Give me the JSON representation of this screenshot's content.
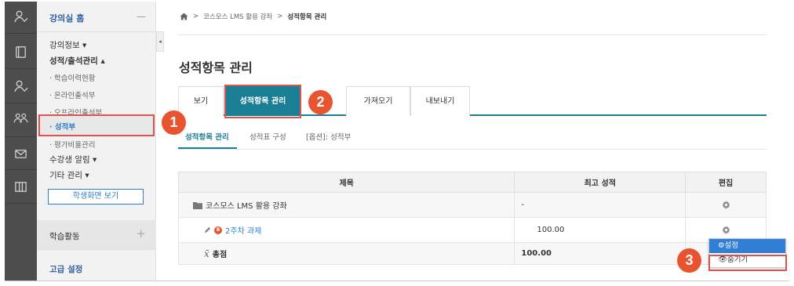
{
  "sidebar": {
    "home_label": "강의실 홈",
    "home_collapse": "—",
    "items": [
      {
        "label": "강의정보 ▾"
      },
      {
        "label": "성적/출석관리 ▴"
      },
      {
        "label": "· 학습이력현황"
      },
      {
        "label": "· 온라인출석부"
      },
      {
        "label": "· 오프라인출석부"
      },
      {
        "label": "· 성적부"
      },
      {
        "label": "· 평가비율관리"
      },
      {
        "label": "수강생 알림 ▾"
      },
      {
        "label": "기타 관리 ▾"
      }
    ],
    "student_view_button": "학생화면 보기",
    "activity_label": "학습활동",
    "activity_plus": "+",
    "advanced_label": "고급 설정"
  },
  "collapse_glyph": "◂",
  "breadcrumb": {
    "sep": ">",
    "course": "코스모스 LMS 활용 강좌",
    "current": "성적항목 관리"
  },
  "page_title": "성적항목 관리",
  "tabs": [
    {
      "label": "보기"
    },
    {
      "label": "성적항목 관리"
    },
    {
      "label": "가져오기"
    },
    {
      "label": "내보내기"
    }
  ],
  "subtabs": [
    {
      "label": "성적항목 관리"
    },
    {
      "label": "성적표 구성"
    },
    {
      "label": "[옵션]: 성적부"
    }
  ],
  "table": {
    "headers": {
      "title": "제목",
      "grade": "최고 성적",
      "edit": "편집"
    },
    "category": {
      "title": "코스모스 LMS 활용 강좌",
      "grade": "-"
    },
    "item": {
      "badge": "B",
      "title": "2주차 과제",
      "grade": "100.00"
    },
    "total": {
      "symbol": "x̄",
      "title": "총점",
      "grade": "100.00"
    }
  },
  "menu": {
    "settings": "⚙설정",
    "hide": "👁숨기기"
  },
  "callouts": [
    "1",
    "2",
    "3"
  ],
  "colors": {
    "accent": "#1a7e95",
    "link": "#2e7fc8",
    "callout": "#e8542f",
    "highlight_border": "#d9534f",
    "rail": "#4d4d4d"
  },
  "icons": [
    "user-icon",
    "book-icon",
    "user-icon",
    "group-icon",
    "mail-icon",
    "library-icon",
    "home-icon",
    "folder-icon",
    "gear-icon",
    "pencil-icon"
  ]
}
